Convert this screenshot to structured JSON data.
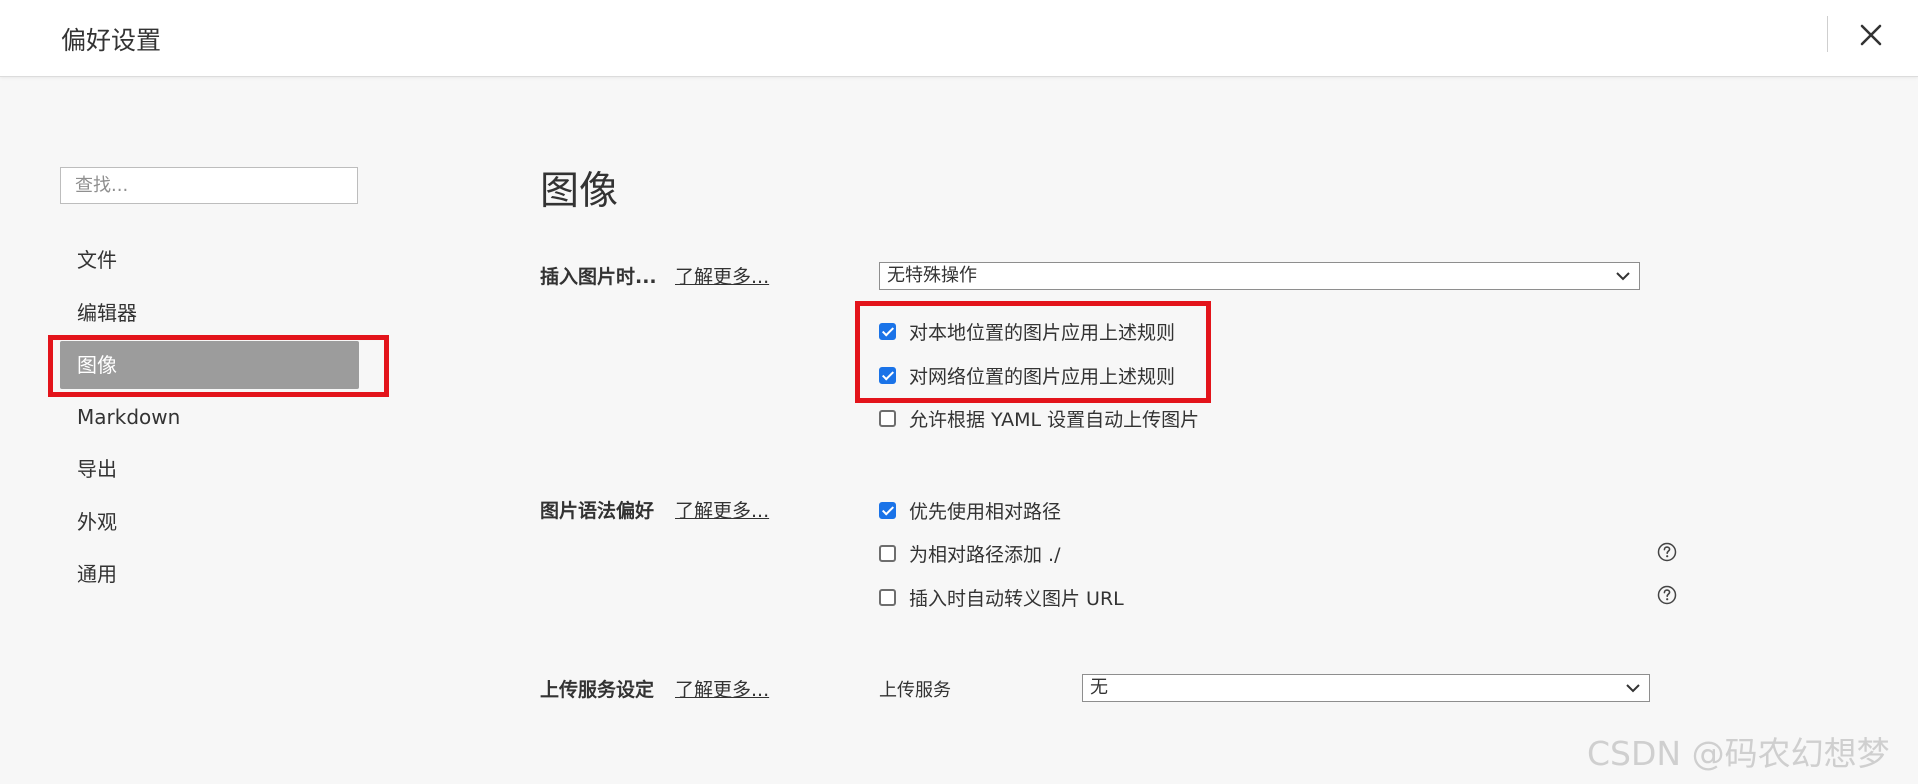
{
  "window": {
    "title": "偏好设置",
    "close_icon": "close-icon"
  },
  "sidebar": {
    "search_placeholder": "查找...",
    "items": [
      {
        "label": "文件"
      },
      {
        "label": "编辑器"
      },
      {
        "label": "图像",
        "active": true
      },
      {
        "label": "Markdown"
      },
      {
        "label": "导出"
      },
      {
        "label": "外观"
      },
      {
        "label": "通用"
      }
    ]
  },
  "main": {
    "heading": "图像",
    "learn_more": "了解更多...",
    "insert_image": {
      "label": "插入图片时...",
      "select_value": "无特殊操作",
      "options": [
        {
          "label": "对本地位置的图片应用上述规则",
          "checked": true
        },
        {
          "label": "对网络位置的图片应用上述规则",
          "checked": true
        },
        {
          "label": "允许根据 YAML 设置自动上传图片",
          "checked": false
        }
      ]
    },
    "syntax_pref": {
      "label": "图片语法偏好",
      "options": [
        {
          "label": "优先使用相对路径",
          "checked": true,
          "help": false
        },
        {
          "label": "为相对路径添加 ./",
          "checked": false,
          "help": true
        },
        {
          "label": "插入时自动转义图片 URL",
          "checked": false,
          "help": true
        }
      ]
    },
    "upload": {
      "label": "上传服务设定",
      "service_label": "上传服务",
      "select_value": "无"
    }
  },
  "colors": {
    "highlight": "#e3141b",
    "active_item": "#9c9c9c",
    "checkbox": "#1a73e8"
  },
  "watermark": "CSDN @码农幻想梦"
}
